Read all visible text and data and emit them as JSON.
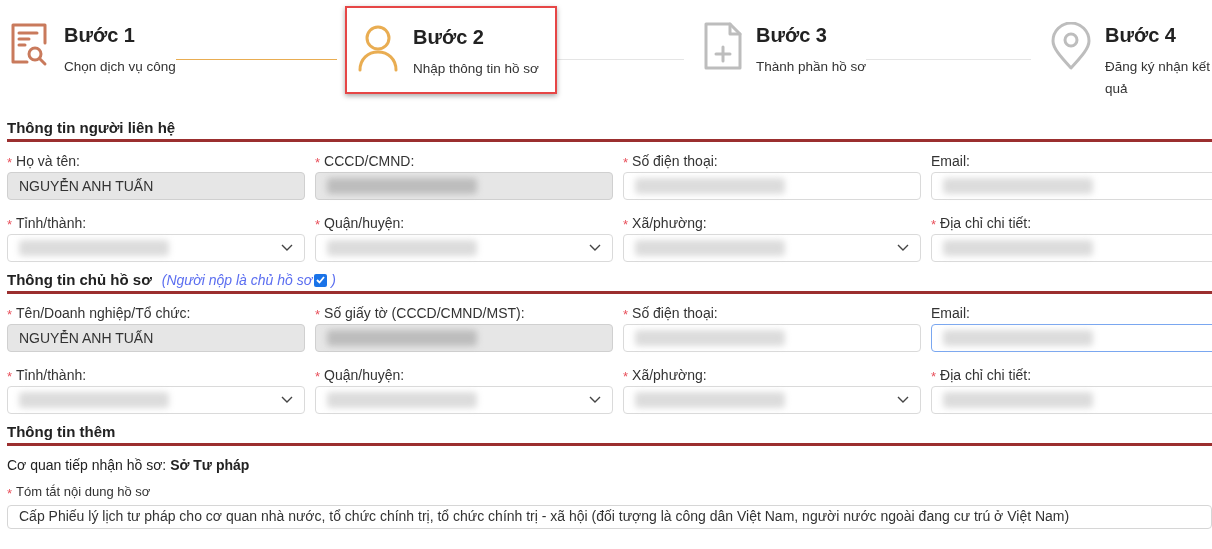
{
  "steps": [
    {
      "title": "Bước 1",
      "subtitle": "Chọn dịch vụ công",
      "kind": "search-doc",
      "done": true,
      "selected": false
    },
    {
      "title": "Bước 2",
      "subtitle": "Nhập thông tin hồ sơ",
      "kind": "person",
      "done": false,
      "selected": true
    },
    {
      "title": "Bước 3",
      "subtitle": "Thành phần hồ sơ",
      "kind": "file-add",
      "done": false,
      "selected": false
    },
    {
      "title": "Bước 4",
      "subtitle": "Đăng ký nhận kết quả",
      "kind": "pin",
      "done": false,
      "selected": false
    }
  ],
  "sections": [
    {
      "title": "Thông tin người liên hệ",
      "fields": [
        {
          "label": "Họ và tên:",
          "mark": "*",
          "kind": "text",
          "value": "NGUYỄN ANH TUẤN",
          "redacted": false,
          "disabled": true,
          "focused": false
        },
        {
          "label": "CCCD/CMND:",
          "mark": "*",
          "kind": "text",
          "redacted": true,
          "disabled": true,
          "focused": false
        },
        {
          "label": "Số điện thoại:",
          "mark": "*",
          "kind": "text",
          "redacted": true,
          "disabled": false,
          "focused": false
        },
        {
          "label": "Email:",
          "kind": "text",
          "redacted": true,
          "disabled": false,
          "focused": false
        },
        {
          "label": "Tỉnh/thành:",
          "mark": "*",
          "kind": "select",
          "redacted": true,
          "disabled": false,
          "focused": false
        },
        {
          "label": "Quận/huyện:",
          "mark": "*",
          "kind": "select",
          "redacted": true,
          "disabled": false,
          "focused": false
        },
        {
          "label": "Xã/phường:",
          "mark": "*",
          "kind": "select",
          "redacted": true,
          "disabled": false,
          "focused": false
        },
        {
          "label": "Địa chỉ chi tiết:",
          "mark": "*",
          "kind": "text",
          "redacted": true,
          "disabled": false,
          "focused": false
        }
      ]
    },
    {
      "title": "Thông tin chủ hồ sơ",
      "note": {
        "text": "(Người nộp là chủ hồ sơ",
        "close": ")",
        "checked": true
      },
      "fields": [
        {
          "label": "Tên/Doanh nghiệp/Tổ chức:",
          "mark": "*",
          "kind": "text",
          "value": "NGUYỄN ANH TUẤN",
          "redacted": false,
          "disabled": true,
          "focused": false
        },
        {
          "label": "Số giấy tờ (CCCD/CMND/MST):",
          "mark": "*",
          "kind": "text",
          "redacted": true,
          "disabled": true,
          "focused": false
        },
        {
          "label": "Số điện thoại:",
          "mark": "*",
          "kind": "text",
          "redacted": true,
          "disabled": false,
          "focused": false
        },
        {
          "label": "Email:",
          "kind": "text",
          "redacted": true,
          "disabled": false,
          "focused": true
        },
        {
          "label": "Tỉnh/thành:",
          "mark": "*",
          "kind": "select",
          "redacted": true,
          "disabled": false,
          "focused": false
        },
        {
          "label": "Quận/huyện:",
          "mark": "*",
          "kind": "select",
          "redacted": true,
          "disabled": false,
          "focused": false
        },
        {
          "label": "Xã/phường:",
          "mark": "*",
          "kind": "select",
          "redacted": true,
          "disabled": false,
          "focused": false
        },
        {
          "label": "Địa chỉ chi tiết:",
          "mark": "*",
          "kind": "text",
          "redacted": true,
          "disabled": false,
          "focused": false
        }
      ]
    }
  ],
  "extra": {
    "title": "Thông tin thêm",
    "agency": "Cơ quan tiếp nhận hồ sơ: **Sở Tư pháp**",
    "summary_label": "Tóm tắt nội dung hồ sơ",
    "summary_mark": "*",
    "summary": "Cấp Phiếu lý lịch tư pháp cho cơ quan nhà nước, tổ chức chính trị, tổ chức chính trị - xã hội (đối tượng là công dân Việt Nam, người nước ngoài đang cư trú ở Việt Nam)"
  }
}
